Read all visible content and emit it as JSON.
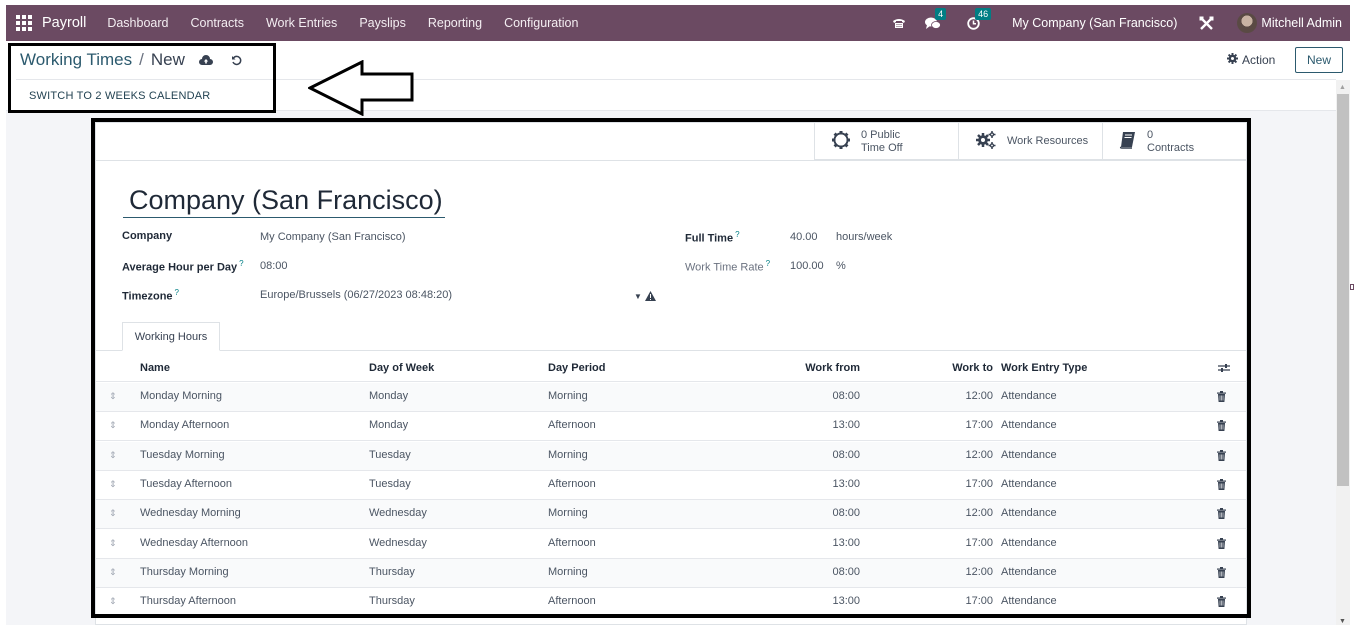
{
  "navbar": {
    "app_name": "Payroll",
    "menu": [
      "Dashboard",
      "Contracts",
      "Work Entries",
      "Payslips",
      "Reporting",
      "Configuration"
    ],
    "messages_badge": "4",
    "activities_badge": "46",
    "company": "My Company (San Francisco)",
    "user": "Mitchell Admin",
    "color": "#6b4a62"
  },
  "control_panel": {
    "breadcrumb_parent": "Working Times",
    "breadcrumb_current": "New",
    "switch_button": "SWITCH TO 2 WEEKS CALENDAR",
    "action_label": "Action",
    "new_label": "New"
  },
  "stat_buttons": [
    {
      "icon": "gear-icon",
      "line1": "0 Public",
      "line2": "Time Off"
    },
    {
      "icon": "gears-icon",
      "line1": "Work Resources",
      "line2": ""
    },
    {
      "icon": "book-icon",
      "line1": "0",
      "line2": "Contracts"
    }
  ],
  "form": {
    "name": "Company (San Francisco)",
    "company_label": "Company",
    "company_value": "My Company (San Francisco)",
    "avg_hour_label": "Average Hour per Day",
    "avg_hour_value": "08:00",
    "timezone_label": "Timezone",
    "timezone_value": "Europe/Brussels (06/27/2023 08:48:20)",
    "full_time_label": "Full Time",
    "full_time_value": "40.00",
    "full_time_unit": "hours/week",
    "rate_label": "Work Time Rate",
    "rate_value": "100.00",
    "rate_unit": "%",
    "help_mark": "?"
  },
  "tabs": [
    "Working Hours"
  ],
  "table": {
    "columns": [
      "Name",
      "Day of Week",
      "Day Period",
      "Work from",
      "Work to",
      "Work Entry Type"
    ],
    "rows": [
      [
        "Monday Morning",
        "Monday",
        "Morning",
        "08:00",
        "12:00",
        "Attendance"
      ],
      [
        "Monday Afternoon",
        "Monday",
        "Afternoon",
        "13:00",
        "17:00",
        "Attendance"
      ],
      [
        "Tuesday Morning",
        "Tuesday",
        "Morning",
        "08:00",
        "12:00",
        "Attendance"
      ],
      [
        "Tuesday Afternoon",
        "Tuesday",
        "Afternoon",
        "13:00",
        "17:00",
        "Attendance"
      ],
      [
        "Wednesday Morning",
        "Wednesday",
        "Morning",
        "08:00",
        "12:00",
        "Attendance"
      ],
      [
        "Wednesday Afternoon",
        "Wednesday",
        "Afternoon",
        "13:00",
        "17:00",
        "Attendance"
      ],
      [
        "Thursday Morning",
        "Thursday",
        "Morning",
        "08:00",
        "12:00",
        "Attendance"
      ],
      [
        "Thursday Afternoon",
        "Thursday",
        "Afternoon",
        "13:00",
        "17:00",
        "Attendance"
      ]
    ]
  }
}
